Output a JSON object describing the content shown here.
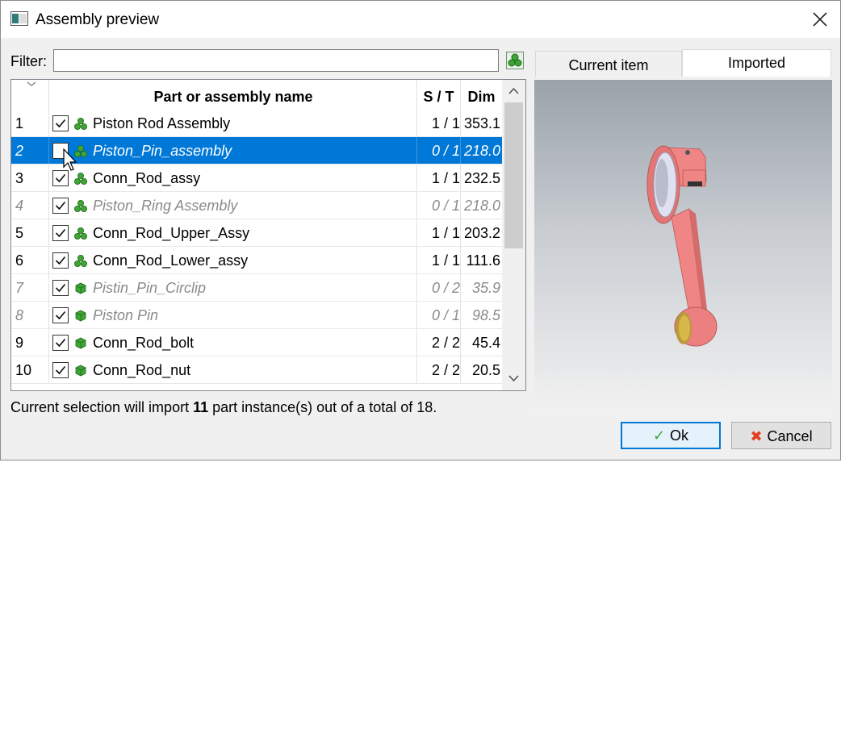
{
  "window": {
    "title": "Assembly preview"
  },
  "filter": {
    "label": "Filter:",
    "value": "",
    "placeholder": ""
  },
  "table": {
    "headers": {
      "name": "Part or assembly name",
      "st": "S / T",
      "dim": "Dim"
    },
    "rows": [
      {
        "num": "1",
        "name": "Piston Rod Assembly",
        "st": "1 / 1",
        "dim": "353.1",
        "checked": true,
        "kind": "assembly",
        "state": "normal"
      },
      {
        "num": "2",
        "name": "Piston_Pin_assembly",
        "st": "0 / 1",
        "dim": "218.0",
        "checked": false,
        "kind": "assembly",
        "state": "selected"
      },
      {
        "num": "3",
        "name": "Conn_Rod_assy",
        "st": "1 / 1",
        "dim": "232.5",
        "checked": true,
        "kind": "assembly",
        "state": "normal"
      },
      {
        "num": "4",
        "name": "Piston_Ring Assembly",
        "st": "0 / 1",
        "dim": "218.0",
        "checked": true,
        "kind": "assembly",
        "state": "dim"
      },
      {
        "num": "5",
        "name": "Conn_Rod_Upper_Assy",
        "st": "1 / 1",
        "dim": "203.2",
        "checked": true,
        "kind": "assembly",
        "state": "normal"
      },
      {
        "num": "6",
        "name": "Conn_Rod_Lower_assy",
        "st": "1 / 1",
        "dim": "111.6",
        "checked": true,
        "kind": "assembly",
        "state": "normal"
      },
      {
        "num": "7",
        "name": "Pistin_Pin_Circlip",
        "st": "0 / 2",
        "dim": "35.9",
        "checked": true,
        "kind": "part",
        "state": "dim"
      },
      {
        "num": "8",
        "name": "Piston Pin",
        "st": "0 / 1",
        "dim": "98.5",
        "checked": true,
        "kind": "part",
        "state": "dim"
      },
      {
        "num": "9",
        "name": "Conn_Rod_bolt",
        "st": "2 / 2",
        "dim": "45.4",
        "checked": true,
        "kind": "part",
        "state": "normal"
      },
      {
        "num": "10",
        "name": "Conn_Rod_nut",
        "st": "2 / 2",
        "dim": "20.5",
        "checked": true,
        "kind": "part",
        "state": "normal"
      }
    ]
  },
  "status": {
    "prefix": "Current selection will import ",
    "count": "11",
    "suffix": " part instance(s) out of a total of 18."
  },
  "tabs": {
    "current_item": "Current item",
    "imported": "Imported",
    "active": "imported"
  },
  "buttons": {
    "ok": "Ok",
    "cancel": "Cancel"
  },
  "icons": {
    "assembly": "assembly-icon",
    "part": "part-cube-icon",
    "ok": "check-icon",
    "cancel": "x-mark-icon"
  },
  "colors": {
    "selection": "#0078d7",
    "icon_green": "#3fa535",
    "model": "#ec8080",
    "cancel_icon": "#e04020"
  }
}
